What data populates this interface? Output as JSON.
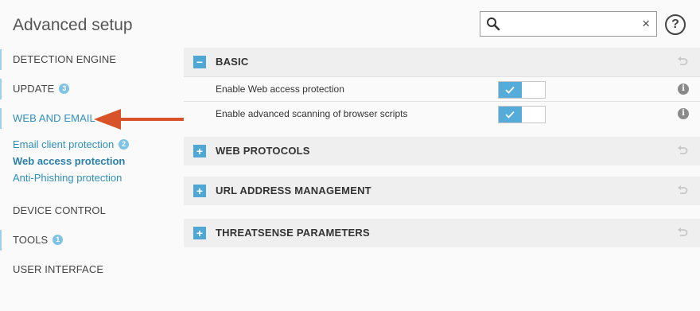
{
  "header": {
    "title": "Advanced setup",
    "search": {
      "value": "",
      "placeholder": ""
    },
    "clear_glyph": "×",
    "help_glyph": "?"
  },
  "sidebar": {
    "items": [
      {
        "label": "DETECTION ENGINE"
      },
      {
        "label": "UPDATE",
        "badge": "3"
      },
      {
        "label": "WEB AND EMAIL"
      },
      {
        "label": "DEVICE CONTROL"
      },
      {
        "label": "TOOLS",
        "badge": "1"
      },
      {
        "label": "USER INTERFACE"
      }
    ],
    "sub_items": [
      {
        "label": "Email client protection",
        "badge": "2"
      },
      {
        "label": "Web access protection"
      },
      {
        "label": "Anti-Phishing protection"
      }
    ]
  },
  "sections": [
    {
      "title": "BASIC",
      "toggle": "−",
      "rows": [
        {
          "label": "Enable Web access protection",
          "enabled": true
        },
        {
          "label": "Enable advanced scanning of browser scripts",
          "enabled": true
        }
      ]
    },
    {
      "title": "WEB PROTOCOLS",
      "toggle": "+"
    },
    {
      "title": "URL ADDRESS MANAGEMENT",
      "toggle": "+"
    },
    {
      "title": "THREATSENSE PARAMETERS",
      "toggle": "+"
    }
  ],
  "info_glyph": "i",
  "colors": {
    "accent": "#4fa7d6",
    "link": "#2e8fbf",
    "arrow": "#d9532a",
    "section_bg": "#efefef"
  }
}
